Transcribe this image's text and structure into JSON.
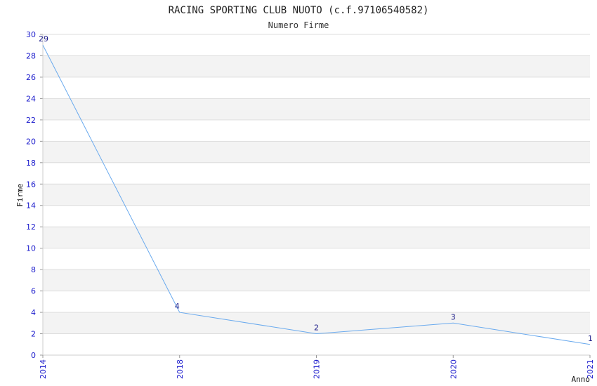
{
  "chart_data": {
    "type": "line",
    "title": "RACING SPORTING CLUB NUOTO (c.f.97106540582)",
    "subtitle": "Numero Firme",
    "xlabel": "Anno",
    "ylabel": "Firme",
    "categories": [
      "2014",
      "2018",
      "2019",
      "2020",
      "2021"
    ],
    "values": [
      29,
      4,
      2,
      3,
      1
    ],
    "data_labels": [
      "29",
      "4",
      "2",
      "3",
      "1"
    ],
    "ylim": [
      0,
      30
    ],
    "yticks": [
      "0",
      "2",
      "4",
      "6",
      "8",
      "10",
      "12",
      "14",
      "16",
      "18",
      "20",
      "22",
      "24",
      "26",
      "28",
      "30"
    ],
    "grid": true,
    "line_color": "#6aaaee",
    "band_color": "#f3f3f3",
    "tick_color": "#1a1acc"
  }
}
